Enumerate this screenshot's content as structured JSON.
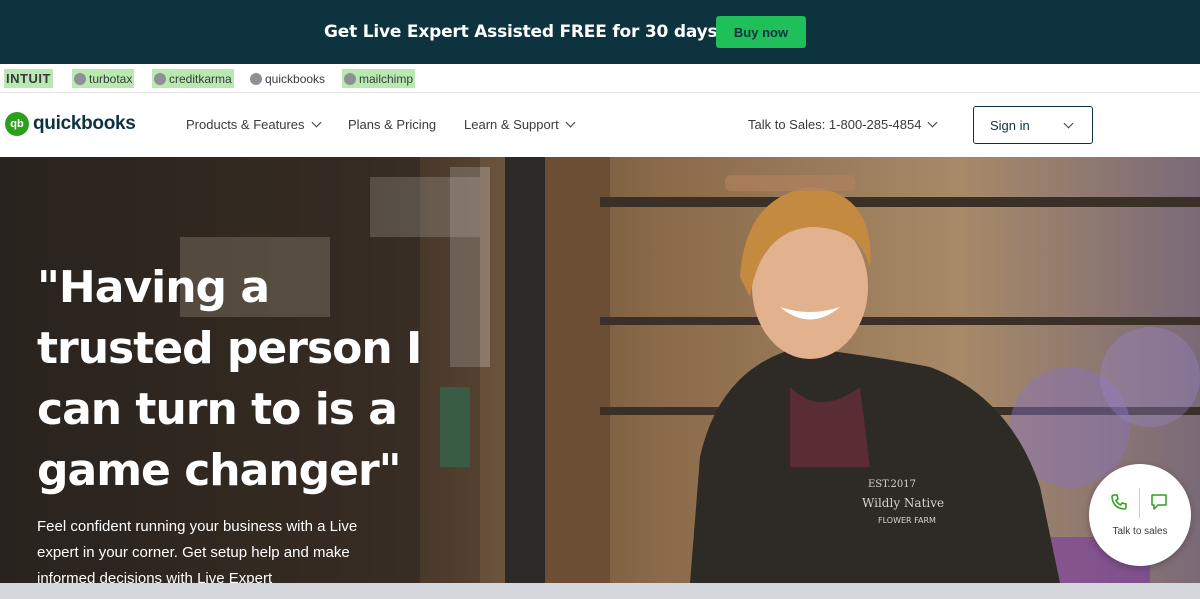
{
  "promo": {
    "text": "Get Live Expert Assisted FREE for 30 days.*",
    "button": "Buy now"
  },
  "brands": {
    "intuit": "INTUIT",
    "turbotax": "turbotax",
    "creditkarma": "creditkarma",
    "quickbooks": "quickbooks",
    "mailchimp": "mailchimp"
  },
  "nav": {
    "logo": "quickbooks",
    "logo_mark": "qb",
    "items": [
      "Products & Features",
      "Plans & Pricing",
      "Learn & Support"
    ],
    "sales": "Talk to Sales: 1-800-285-4854",
    "signin": "Sign in"
  },
  "hero": {
    "headline": "\"Having a trusted person I can turn to is a game changer\"",
    "sub": "Feel confident running your business with a Live expert in your corner. Get setup help and make informed decisions with Live Expert"
  },
  "fab": {
    "label": "Talk to sales",
    "icons": [
      "phone-icon",
      "chat-icon"
    ]
  },
  "colors": {
    "promo_bg": "#0d333f",
    "accent": "#1fbf5a",
    "brand_green": "#2ca01c"
  }
}
